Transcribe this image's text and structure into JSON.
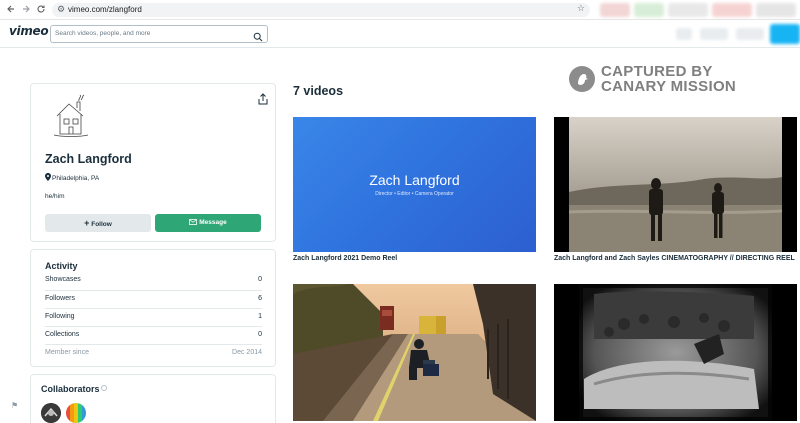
{
  "browser": {
    "url": "vimeo.com/zlangford",
    "back_icon": "arrow-left-icon",
    "forward_icon": "arrow-right-icon",
    "reload_icon": "reload-icon"
  },
  "header": {
    "logo": "vimeo",
    "search_placeholder": "Search videos, people, and more"
  },
  "profile": {
    "name": "Zach Langford",
    "location": "Philadelphia, PA",
    "pronouns": "he/him",
    "follow_label": "Follow",
    "message_label": "Message"
  },
  "activity": {
    "title": "Activity",
    "rows": [
      {
        "label": "Showcases",
        "value": "0"
      },
      {
        "label": "Followers",
        "value": "6"
      },
      {
        "label": "Following",
        "value": "1"
      },
      {
        "label": "Collections",
        "value": "0"
      },
      {
        "label": "Member since",
        "value": "Dec 2014"
      }
    ]
  },
  "collaborators": {
    "title": "Collaborators"
  },
  "main": {
    "video_count": "7 videos",
    "watermark_line1": "CAPTURED BY",
    "watermark_line2": "CANARY MISSION",
    "videos": [
      {
        "title": "Zach Langford 2021 Demo Reel",
        "thumb_title": "Zach Langford",
        "thumb_subtitle": "Director • Editor • Camera Operator"
      },
      {
        "title": "Zach Langford and Zach Sayles CINEMATOGRAPHY // DIRECTING REEL"
      },
      {
        "title": ""
      },
      {
        "title": ""
      }
    ]
  },
  "colors": {
    "brand_text": "#1a2e3b",
    "message_green": "#2fa676",
    "vimeo_blue": "#17b4f4",
    "demo_reel_blue": "#2f72de"
  }
}
